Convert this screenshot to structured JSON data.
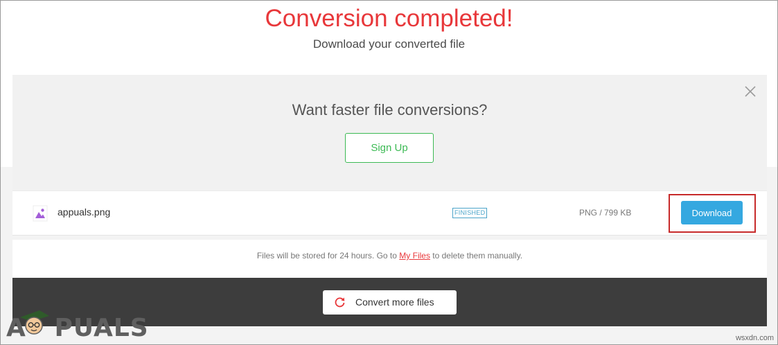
{
  "header": {
    "title": "Conversion completed!",
    "subtitle": "Download your converted file"
  },
  "promo": {
    "heading": "Want faster file conversions?",
    "signup_label": "Sign Up",
    "close_icon": "close-icon"
  },
  "file": {
    "icon": "image-file-icon",
    "name": "appuals.png",
    "status": "FINISHED",
    "size": "PNG / 799 KB",
    "download_label": "Download"
  },
  "info": {
    "text_before": "Files will be stored for 24 hours. Go to ",
    "link_label": "My Files",
    "text_after": " to delete them manually."
  },
  "footer": {
    "convert_more_label": "Convert more files",
    "convert_icon": "refresh-icon"
  },
  "branding": {
    "logo_text": "APPUALS",
    "watermark": "wsxdn.com"
  },
  "colors": {
    "title_red": "#e8373a",
    "signup_green": "#3cba54",
    "download_blue": "#35a8e0",
    "status_blue": "#4aa3c9",
    "highlight_red": "#c72a2a",
    "dark_bar": "#3d3d3d"
  }
}
